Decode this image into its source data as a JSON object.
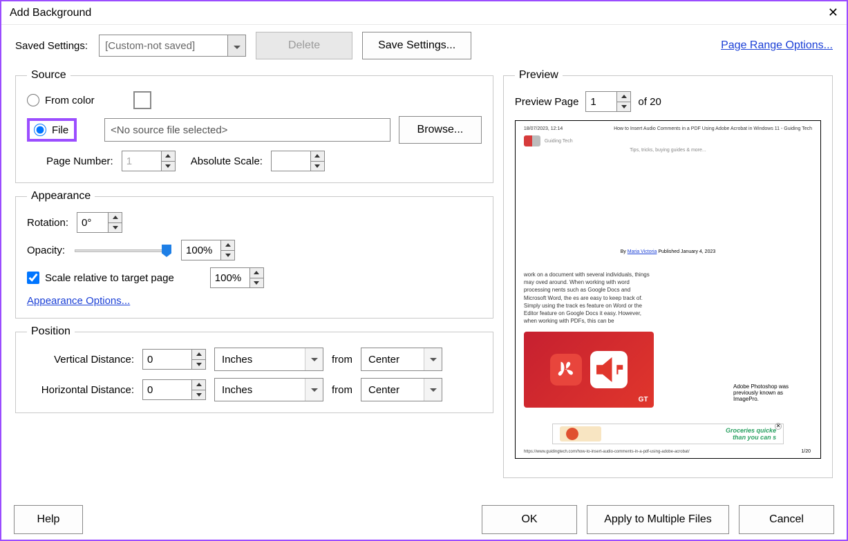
{
  "title": "Add Background",
  "saved_settings": {
    "label": "Saved Settings:",
    "value": "[Custom-not saved]",
    "delete": "Delete",
    "save": "Save Settings..."
  },
  "page_range_link": "Page Range Options...",
  "source": {
    "legend": "Source",
    "from_color": "From color",
    "file": "File",
    "file_value": "<No source file selected>",
    "browse": "Browse...",
    "page_number_label": "Page Number:",
    "page_number": "1",
    "absolute_scale_label": "Absolute Scale:",
    "absolute_scale": ""
  },
  "appearance": {
    "legend": "Appearance",
    "rotation_label": "Rotation:",
    "rotation": "0°",
    "opacity_label": "Opacity:",
    "opacity": "100%",
    "scale_relative": "Scale relative to target page",
    "scale_value": "100%",
    "options_link": "Appearance Options..."
  },
  "position": {
    "legend": "Position",
    "vdist_label": "Vertical Distance:",
    "vdist": "0",
    "hdist_label": "Horizontal Distance:",
    "hdist": "0",
    "units": "Inches",
    "from": "from",
    "anchor": "Center"
  },
  "preview": {
    "legend": "Preview",
    "page_label": "Preview Page",
    "page": "1",
    "of_total": "of 20",
    "doc": {
      "datetime": "18/07/2023, 12:14",
      "heading": "How to Insert Audio Comments in a PDF Using Adobe Acrobat in Windows 11 - Guiding Tech",
      "brand": "Guiding Tech",
      "tagline": "Tips, tricks, buying guides & more...",
      "byline_prefix": "By ",
      "byline_author": "Maria Victoria",
      "byline_suffix": "  Published January 4, 2023",
      "para": "work on a document with several individuals, things may oved around. When working with word processing nents such as Google Docs and Microsoft Word, the es are easy to keep track of. Simply using the track es feature on Word or the Editor feature on Google Docs it easy. However, when working with PDFs, this can be",
      "side": "Adobe Photoshop was previously known as ImagePro.",
      "ad1": "Groceries quicke",
      "ad2": "than you can s",
      "url": "https://www.guidingtech.com/how-to-insert-audio-comments-in-a-pdf-using-adobe-acrobat/",
      "pagefrac": "1/20"
    }
  },
  "footer": {
    "help": "Help",
    "ok": "OK",
    "apply": "Apply to Multiple Files",
    "cancel": "Cancel"
  }
}
